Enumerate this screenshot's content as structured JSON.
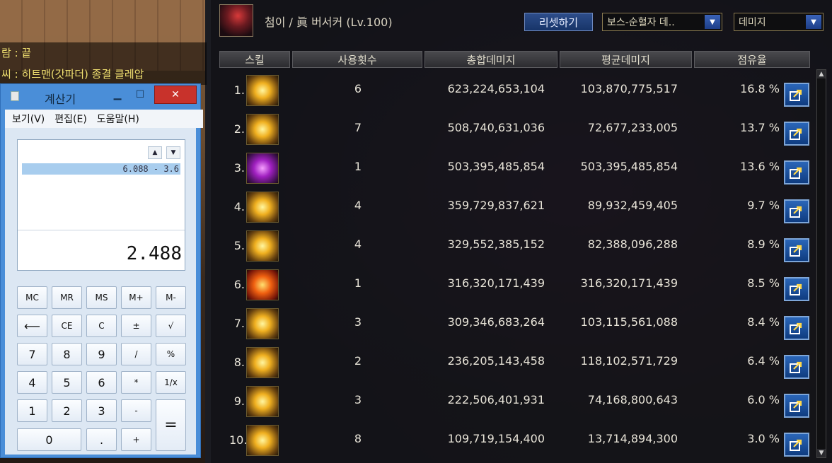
{
  "game": {
    "chat_lines": [
      "람 : 끝",
      "씨 : 히트맨(갓파더) 종결 클레압"
    ]
  },
  "panel": {
    "character_title": "첨이 / 眞 버서커 (Lv.100)",
    "reset_button": "리셋하기",
    "target_dropdown": "보스-순혈자 데..",
    "mode_dropdown": "데미지",
    "columns": [
      "스킬",
      "사용횟수",
      "총합데미지",
      "평균데미지",
      "점유율"
    ],
    "rows": [
      {
        "rank": "1.",
        "uses": "6",
        "total": "623,224,653,104",
        "avg": "103,870,775,517",
        "share": "16.8 %",
        "icon": "gold"
      },
      {
        "rank": "2.",
        "uses": "7",
        "total": "508,740,631,036",
        "avg": "72,677,233,005",
        "share": "13.7 %",
        "icon": "gold"
      },
      {
        "rank": "3.",
        "uses": "1",
        "total": "503,395,485,854",
        "avg": "503,395,485,854",
        "share": "13.6 %",
        "icon": "purple"
      },
      {
        "rank": "4.",
        "uses": "4",
        "total": "359,729,837,621",
        "avg": "89,932,459,405",
        "share": "9.7 %",
        "icon": "gold"
      },
      {
        "rank": "5.",
        "uses": "4",
        "total": "329,552,385,152",
        "avg": "82,388,096,288",
        "share": "8.9 %",
        "icon": "gold"
      },
      {
        "rank": "6.",
        "uses": "1",
        "total": "316,320,171,439",
        "avg": "316,320,171,439",
        "share": "8.5 %",
        "icon": "fire"
      },
      {
        "rank": "7.",
        "uses": "3",
        "total": "309,346,683,264",
        "avg": "103,115,561,088",
        "share": "8.4 %",
        "icon": "gold"
      },
      {
        "rank": "8.",
        "uses": "2",
        "total": "236,205,143,458",
        "avg": "118,102,571,729",
        "share": "6.4 %",
        "icon": "gold"
      },
      {
        "rank": "9.",
        "uses": "3",
        "total": "222,506,401,931",
        "avg": "74,168,800,643",
        "share": "6.0 %",
        "icon": "gold"
      },
      {
        "rank": "10.",
        "uses": "8",
        "total": "109,719,154,400",
        "avg": "13,714,894,300",
        "share": "3.0 %",
        "icon": "gold"
      }
    ]
  },
  "calculator": {
    "title": "계산기",
    "menu": [
      "보기(V)",
      "편집(E)",
      "도움말(H)"
    ],
    "expression": "6.088 - 3.6",
    "result": "2.488",
    "keys": {
      "mc": "MC",
      "mr": "MR",
      "ms": "MS",
      "mplus": "M+",
      "mminus": "M-",
      "back": "⟵",
      "ce": "CE",
      "c": "C",
      "plusminus": "±",
      "sqrt": "√",
      "n7": "7",
      "n8": "8",
      "n9": "9",
      "div": "/",
      "pct": "%",
      "n4": "4",
      "n5": "5",
      "n6": "6",
      "mul": "*",
      "inv": "1/x",
      "n1": "1",
      "n2": "2",
      "n3": "3",
      "sub": "-",
      "eq": "=",
      "n0": "0",
      "dot": ".",
      "add": "+"
    }
  },
  "colors": {
    "accent": "#4a8ed8",
    "close": "#c8322b",
    "export_button": "#2a66b8"
  }
}
